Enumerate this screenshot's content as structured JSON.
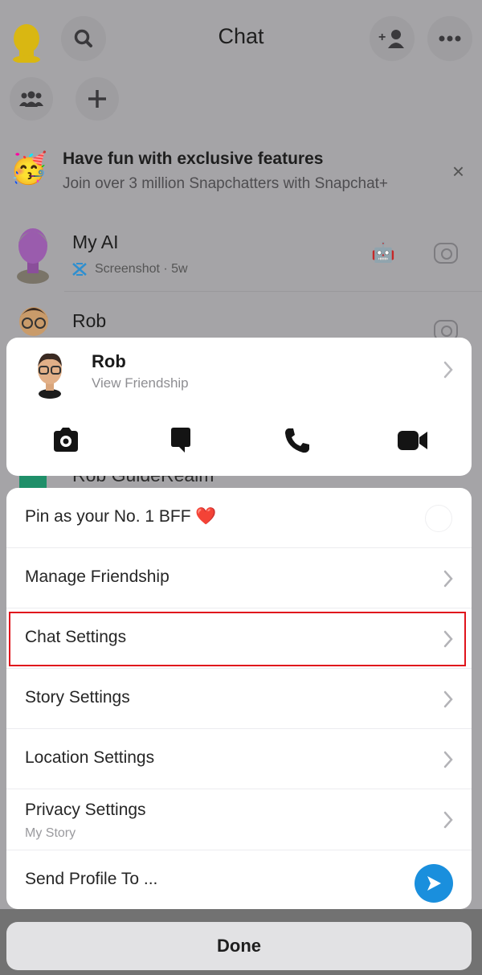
{
  "header": {
    "title": "Chat",
    "icons": [
      "bitmoji-avatar",
      "search-icon",
      "add-friend-icon",
      "more-icon"
    ],
    "secondary_icons": [
      "groups-icon",
      "plus-icon"
    ]
  },
  "promo": {
    "title": "Have fun with exclusive features",
    "subtitle": "Join over 3 million Snapchatters with Snapchat+",
    "emoji": "🥳",
    "close_icon": "×"
  },
  "chats": [
    {
      "name": "My AI",
      "status_icon": "screenshot-icon",
      "status": "Screenshot · 5w",
      "badge": "🤖"
    },
    {
      "name": "Rob"
    },
    {
      "name": "Rob GuideRealm"
    }
  ],
  "friend_card": {
    "name": "Rob",
    "subtitle": "View Friendship",
    "actions": [
      "camera",
      "chat",
      "call",
      "video"
    ]
  },
  "menu": {
    "items": [
      {
        "label": "Pin as your No. 1 BFF ❤️",
        "type": "radio"
      },
      {
        "label": "Manage Friendship",
        "type": "chevron"
      },
      {
        "label": "Chat Settings",
        "type": "chevron",
        "highlighted": true
      },
      {
        "label": "Story Settings",
        "type": "chevron"
      },
      {
        "label": "Location Settings",
        "type": "chevron"
      },
      {
        "label": "Privacy Settings",
        "sublabel": "My Story",
        "type": "chevron"
      },
      {
        "label": "Send Profile To ...",
        "type": "send"
      }
    ]
  },
  "done_label": "Done",
  "colors": {
    "highlight_border": "#e0141c",
    "send_button": "#1a8fdd",
    "bitmoji_yellow": "#e8c20e"
  }
}
